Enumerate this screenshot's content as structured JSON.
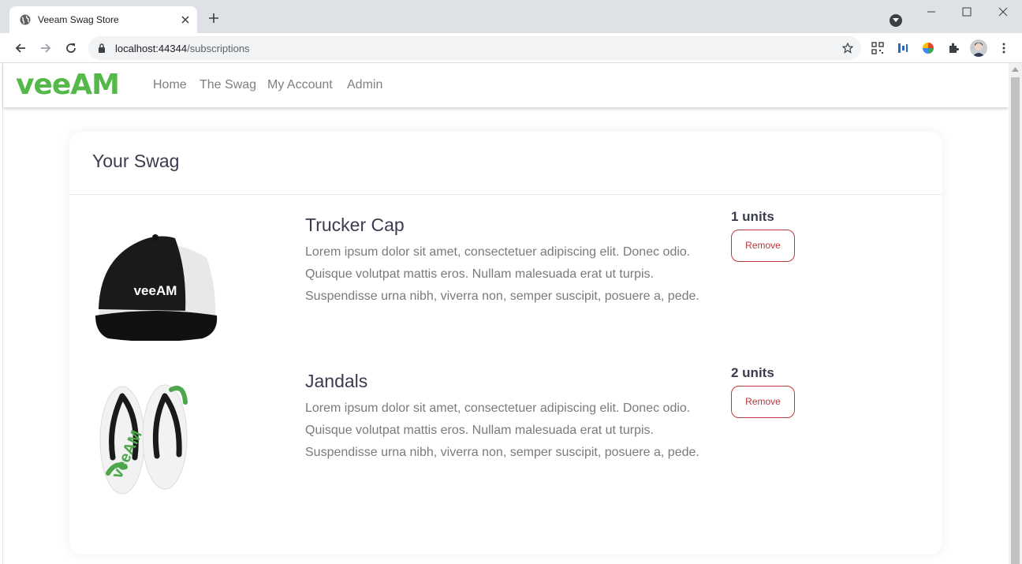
{
  "browser": {
    "tab_title": "Veeam Swag Store",
    "url_host": "localhost:44344",
    "url_path": "/subscriptions"
  },
  "site": {
    "brand": "veeAM",
    "brand_color": "#54b948",
    "nav": [
      "Home",
      "The Swag",
      "My Account",
      "Admin"
    ]
  },
  "cart": {
    "heading": "Your Swag",
    "items": [
      {
        "name": "Trucker Cap",
        "description": "Lorem ipsum dolor sit amet, consectetuer adipiscing elit. Donec odio. Quisque volutpat mattis eros. Nullam malesuada erat ut turpis. Suspendisse urna nibh, viverra non, semper suscipit, posuere a, pede.",
        "units": "1 units",
        "remove_label": "Remove",
        "image_text": "veeAM"
      },
      {
        "name": "Jandals",
        "description": "Lorem ipsum dolor sit amet, consectetuer adipiscing elit. Donec odio. Quisque volutpat mattis eros. Nullam malesuada erat ut turpis. Suspendisse urna nibh, viverra non, semper suscipit, posuere a, pede.",
        "units": "2 units",
        "remove_label": "Remove",
        "image_text": "veeAM"
      }
    ]
  },
  "colors": {
    "accent_green": "#54b948",
    "remove_red": "#c0393b",
    "heading_text": "#3a3b4f"
  }
}
